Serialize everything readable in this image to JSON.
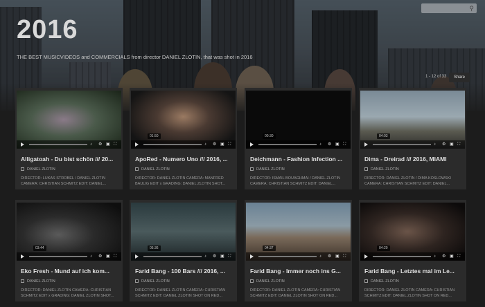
{
  "hero": {
    "title": "2016",
    "description": "THE BEST MUSICVIDEOS and COMMERCIALS from director DANIEL ZLOTIN, that was shot in 2016"
  },
  "search": {
    "placeholder": "",
    "icon": "search-icon"
  },
  "pagination": {
    "count": "1 - 12 of 33"
  },
  "share_label": "Share",
  "colors": {
    "page_bg": "#1c1c1c",
    "card_bg": "#2b2b2b",
    "text": "#e0e0e0"
  },
  "videos": [
    {
      "title": "Alligatoah - Du bist schön /// 20...",
      "author": "DANIEL ZLOTIN",
      "description": "DIRECTOR: LUKAS STROBEL / DANIEL ZLOTIN CAMERA: CHRISTIAN SCHMITZ EDIT: DANIEL...",
      "time": ""
    },
    {
      "title": "ApoRed - Numero Uno /// 2016, ...",
      "author": "DANIEL ZLOTIN",
      "description": "DIRECTOR: DANIEL ZLOTIN CAMERA: MANFRED BAULIG EDIT x GRADING: DANIEL ZLOTIN SHOT...",
      "time": "01:50"
    },
    {
      "title": "Deichmann - Fashion Infection ...",
      "author": "DANIEL ZLOTIN",
      "description": "DIRECTOR: ISMAIL BOUAGHMAI / DANIEL ZLOTIN CAMERA: CHRISTIAN SCHMITZ EDIT: DANIEL...",
      "time": "00:30"
    },
    {
      "title": "Dima - Dreirad /// 2016, MIAMI",
      "author": "DANIEL ZLOTIN",
      "description": "DIRECTOR: DANIEL ZLOTIN / DIMA KOSLOWSKI CAMERA: CHRISTIAN SCHMITZ EDIT: DANIEL...",
      "time": "04:03"
    },
    {
      "title": "Eko Fresh - Mund auf ich kom...",
      "author": "DANIEL ZLOTIN",
      "description": "DIRECTOR: DANIEL ZLOTIN CAMERA: CHRISTIAN SCHMITZ EDIT x GRADING: DANIEL ZLOTIN SHOT...",
      "time": "03:44"
    },
    {
      "title": "Farid Bang - 100 Bars /// 2016, ...",
      "author": "DANIEL ZLOTIN",
      "description": "DIRECTOR: DANIEL ZLOTIN CAMERA: CHRISTIAN SCHMITZ EDIT: DANIEL ZLOTIN SHOT ON RED...",
      "time": "05:36"
    },
    {
      "title": "Farid Bang - Immer noch ins G...",
      "author": "DANIEL ZLOTIN",
      "description": "DIRECTOR: DANIEL ZLOTIN CAMERA: CHRISTIAN SCHMITZ EDIT: DANIEL ZLOTIN SHOT ON RED...",
      "time": "04:37"
    },
    {
      "title": "Farid Bang - Letztes mal im Le...",
      "author": "DANIEL ZLOTIN",
      "description": "DIRECTOR: DANIEL ZLOTIN CAMERA: CHRISTIAN SCHMITZ EDIT: DANIEL ZLOTIN SHOT ON RED...",
      "time": "04:20"
    }
  ]
}
